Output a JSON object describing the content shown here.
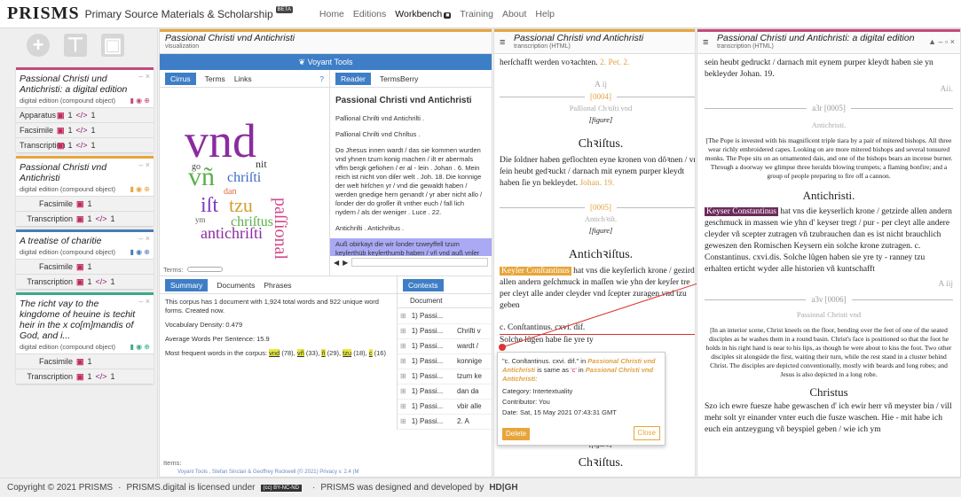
{
  "header": {
    "logo": "PRISMS",
    "tagline": "Primary Source Materials & Scholarship",
    "beta": "BETA",
    "nav": [
      "Home",
      "Editions",
      "Workbench",
      "Training",
      "About",
      "Help"
    ]
  },
  "sidebar": {
    "cards": [
      {
        "title": "Passional Christi und Antichristi: a digital edition",
        "subtitle": "digital edition (compound object)",
        "color": "#c64a7a",
        "rows": [
          {
            "label": "Apparatus",
            "c1": "1",
            "c2": "1"
          },
          {
            "label": "Facsimile",
            "c1": "1",
            "c2": "1"
          },
          {
            "label": "Transcription",
            "c1": "1",
            "c2": "1"
          }
        ]
      },
      {
        "title": "Passional Christi vnd Antichristi",
        "subtitle": "digital edition (compound object)",
        "color": "#e7a53b",
        "rows": [
          {
            "label": "Facsimile",
            "c1": "1",
            "c2": ""
          },
          {
            "label": "Transcription",
            "c1": "1",
            "c2": "1"
          }
        ]
      },
      {
        "title": "A treatise of charitie",
        "subtitle": "digital edition (compound object)",
        "color": "#4a7ab8",
        "rows": [
          {
            "label": "Facsimile",
            "c1": "1",
            "c2": ""
          },
          {
            "label": "Transcription",
            "c1": "1",
            "c2": "1"
          }
        ]
      },
      {
        "title": "The richt vay to the kingdome of heuine is techit heir in the x co[m]mandis of God, and i...",
        "subtitle": "digital edition (compound object)",
        "color": "#3aaa8a",
        "rows": [
          {
            "label": "Facsimile",
            "c1": "1",
            "c2": ""
          },
          {
            "label": "Transcription",
            "c1": "1",
            "c2": "1"
          }
        ]
      }
    ]
  },
  "viz": {
    "title": "Passional Christi vnd Antichristi",
    "subtitle": "visualization",
    "voyant": "Voyant Tools",
    "tabs1": [
      "Cirrus",
      "Terms",
      "Links"
    ],
    "tabs2": [
      "Reader",
      "TermsBerry"
    ],
    "reader_title": "Passional Christi vnd Antichristi",
    "reader_lines": [
      "Paſſional Chriſti vnd Antichriſti .",
      "Paſſional Chriſti vnd Chriſtus .",
      "Do Jhesus innen wardt / das sie kommen wurden vnd yhnen tzum konig machen / ilt er abermals vffm bergk gefiohen / er al - lein . Johan . 6. Mein reich ist nicht von diſer welt . Joh. 18. Die konnige der welt hirſchen yr / vnd die gewaldt haben / werden gnedige hern genandt / yr aber nicht alſo / ſonder der do groſſer iſt vnther euch / fall lich nydern / als der weniger . Luce . 22.",
      "Antichriſti . Antichriſtus .",
      "Auß obirkayt die wir ſonder tzweyffell tzum keyſerthüb keyſerthumb haben / vñ vnd auß vnſer"
    ],
    "terms_label": "Terms:",
    "items_label": "Items:",
    "tabs3": [
      "Summary",
      "Documents",
      "Phrases"
    ],
    "tabs4": [
      "Contexts"
    ],
    "summary": {
      "line1": "This corpus has 1 document with 1,924 total words and 922 unique word forms. Created now.",
      "density": "Vocabulary Density: 0.479",
      "avg": "Average Words Per Sentence: 15.9",
      "freq_label": "Most frequent words in the corpus:",
      "freq": [
        {
          "w": "vnd",
          "n": "(78)"
        },
        {
          "w": "vñ",
          "n": "(33)"
        },
        {
          "w": "ñ",
          "n": "(29)"
        },
        {
          "w": "tzu",
          "n": "(18)"
        },
        {
          "w": "c",
          "n": "(16)"
        }
      ]
    },
    "contexts_header": "Document",
    "contexts": [
      {
        "d": "1) Passi...",
        "l": ""
      },
      {
        "d": "1) Passi...",
        "l": "Chriſti v"
      },
      {
        "d": "1) Passi...",
        "l": "wardt /"
      },
      {
        "d": "1) Passi...",
        "l": "konnige"
      },
      {
        "d": "1) Passi...",
        "l": "tzum ke"
      },
      {
        "d": "1) Passi...",
        "l": "dan da"
      },
      {
        "d": "1) Passi...",
        "l": "vbir alle"
      },
      {
        "d": "1) Passi...",
        "l": "2. A"
      }
    ],
    "footer": "Voyant Tools , Stefan Sinclair & Geoffrey Rockwell (© 2021) Privacy v. 2.4 (M"
  },
  "mid": {
    "title": "Passional Christi vnd Antichristi",
    "subtitle": "transcription (HTML)",
    "line_a": "herſchafft werden voꝛachten.",
    "ref_a": "2. Pet. 2.",
    "sig_a": "A ij",
    "num1": "[0004]",
    "head1": "Paſſional Chꝛiſti vnd",
    "fig": "[figure]",
    "h_christus": "Chꝛiſtus.",
    "p1": "Die ſoldner haben geflochten eyne kronen von dôꝛnen / vnd ſein heubt gedꝛuckt / darnach mit eynem purper kleydt haben ſie yn bekleydet.",
    "ref_b": "Johan. 19.",
    "num2": "[0005]",
    "head2": "Antichꝛiſt.",
    "h_anti": "Antichꝛiſtus.",
    "hl": "Keyſer Conſtantinus",
    "p2": "hat vns die keyſerlich krone / gezirde allen andern geſchmuck in maſſen wie yhn der keyſer tre per cleyt alle ander cleyder vnd ſcepter zuragen vnd tzu geben",
    "p3": "c. Conſtantinus. cxvi. dif.",
    "p4": "Solche lûgen habe  ſie yre ty",
    "h_christus2": "Chꝛiſtus."
  },
  "popup": {
    "quote": "\"c. Conſtantinus. cxvi. dif.\" in",
    "src": "Passional Christi vnd Antichristi",
    "same": "is same as",
    "target": "'c'",
    "in": "in",
    "tsrc": "Passional Christi vnd Antichristi:",
    "category": "Category: Intertextuality",
    "contributor": "Contributor: You",
    "date": "Date: Sat, 15 May 2021 07:43:31 GMT",
    "delete": "Delete",
    "close": "Close"
  },
  "right": {
    "title": "Passional Christi und Antichristi: a digital edition",
    "subtitle": "transcription (HTML)",
    "l0": "sein heubt gedruckt / darnach mit eynem purper kleydt haben sie yn bekleyder Johan. 19.",
    "aii": "Aii.",
    "num1": "a3r [0005]",
    "anti_small": "Antichristi.",
    "desc1": "[The Pope is invested with his magnificent triple tiara by a pair of mitered bishops. All three wear richly embroidered capes. Looking on are more mitered bishops and several tonsured monks. The Pope sits on an ornamented dais, and one of the bishops bears an incense burner. Through a doorway we glimpse three heralds blowing trumpets; a flaming bonfire; and a group of people preparing to fire off a cannon.",
    "h_anti": "Antichristi.",
    "hl": "Keyser Constantinus",
    "p1": "hat vns die keyserlich krone / getzirde allen andern geschmuck in massen wie yhn d' keyser tregt / pur - per cleyt alle andere cleyder vñ scepter zutragen vñ tzubrauchen dan es ist nicht brauchlich geweszen den Romischen Keysern ein solche krone zutragen.",
    "p1b": "c. Constantinus. cxvi.dis. Solche lûgen haben sie yre ty - ranney tzu erhalten erticht wyder alle historien vñ kuntschafft",
    "aiij": "A iij",
    "num2": "a3v [0006]",
    "head2": "Passional Christi vnd",
    "desc2": "[In an interior scene, Christ kneels on the floor, bending over the feet of one of the seated disciples as he washes them in a round basin. Christ's face is positioned so that the foot he holds in his right hand is near to his lips, as though he were about to kiss the foot. Two other disciples sit alongside the first, waiting their turn, while the rest stand in a cluster behind Christ. The disciples are depicted conventionally, mostly with beards and long robes; and Jesus is also depicted in a long robe.",
    "h_christus": "Christus",
    "p2": "Szo ich ewre fuesze habe gewaschen d' ich ewir herr vñ meyster bin / vill mehr solt yr einander vnter euch die fusze waschen. Hie - mit habe ich euch ein antzeygung vñ beyspiel geben / wie ich ym"
  },
  "footer": {
    "copy": "Copyright © 2021 PRISMS",
    "dot": "·",
    "license": "PRISMS.digital is licensed under",
    "cc": "(cc) BY-NC-ND",
    "designed": "PRISMS was designed and developed by",
    "brand": "HD|GH"
  },
  "colors": {
    "pink": "#c64a7a",
    "orange": "#e7a53b",
    "blue": "#3e7ec6",
    "teal": "#3aaa8a",
    "highlight": "#6b2b5a"
  }
}
